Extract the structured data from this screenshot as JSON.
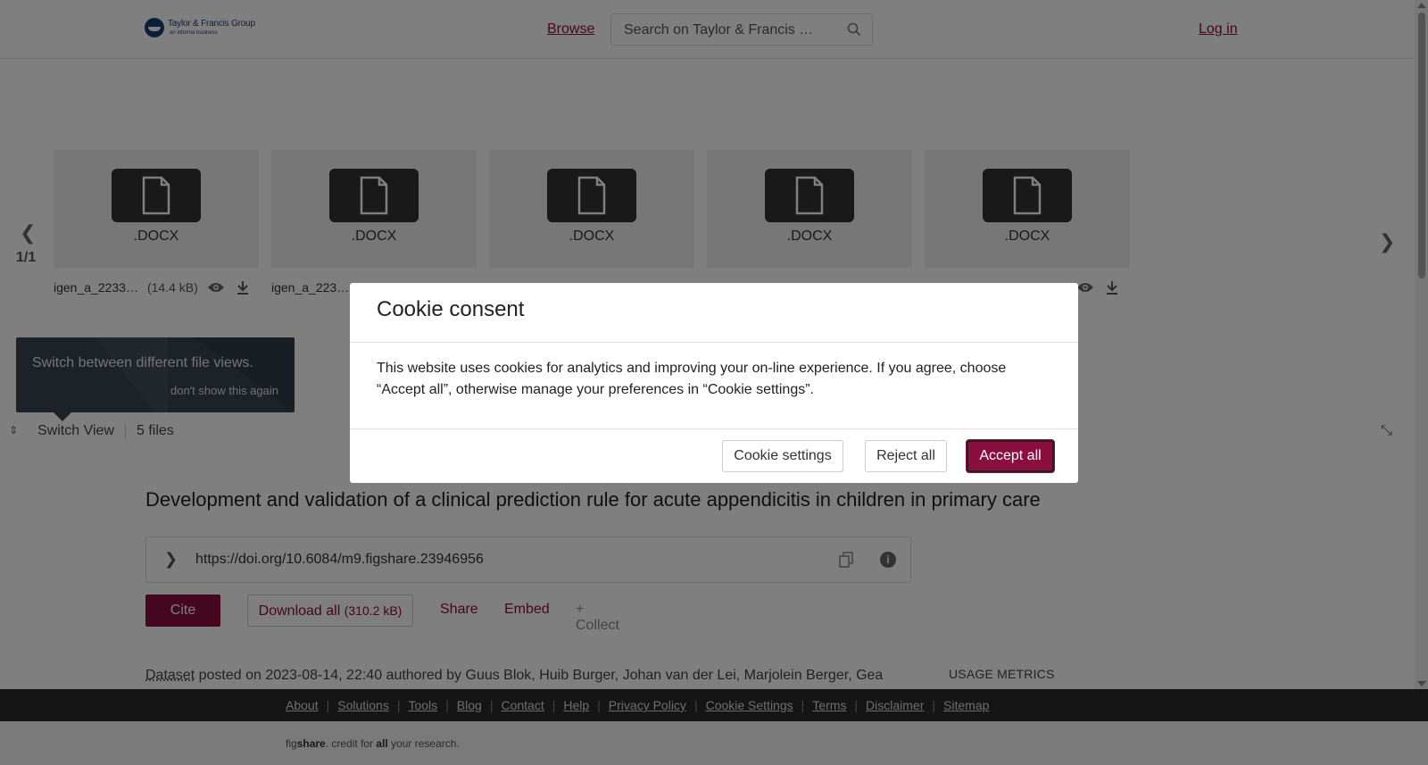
{
  "header": {
    "logo_main": "Taylor & Francis Group",
    "logo_sub": "an informa business",
    "browse": "Browse",
    "search_placeholder": "Search on Taylor & Francis …",
    "login": "Log in"
  },
  "carousel": {
    "counter": "1/1",
    "files": [
      {
        "ext": ".DOCX",
        "name": "igen_a_2233…",
        "size": "(14.4 kB)"
      },
      {
        "ext": ".DOCX",
        "name": "igen_a_223…",
        "size": ""
      },
      {
        "ext": ".DOCX",
        "name": "",
        "size": ""
      },
      {
        "ext": ".DOCX",
        "name": "",
        "size": ""
      },
      {
        "ext": ".DOCX",
        "name": "",
        "size": ""
      }
    ],
    "tooltip_text": "Switch between different file views.",
    "tooltip_dismiss": "don't show this again",
    "switch_view": "Switch View",
    "files_count": "5 files"
  },
  "main": {
    "title": "Development and validation of a clinical prediction rule for acute appendicitis in children in primary care",
    "doi": "https://doi.org/10.6084/m9.figshare.23946956",
    "cite": "Cite",
    "download_all": "Download all",
    "download_size": "(310.2 kB)",
    "share": "Share",
    "embed": "Embed",
    "collect": "+ Collect",
    "posted_type": "Dataset",
    "posted_rest": "posted on 2023-08-14, 22:40 authored by Guus Blok, Huib Burger, Johan van der Lei, Marjolein Berger, Gea Holtman",
    "usage_metrics": "USAGE METRICS"
  },
  "footer": {
    "links": [
      "About",
      "Solutions",
      "Tools",
      "Blog",
      "Contact",
      "Help",
      "Privacy Policy",
      "Cookie Settings",
      "Terms",
      "Disclaimer",
      "Sitemap"
    ],
    "credit_pre": "fig",
    "credit_brand": "share",
    "credit_mid": ". credit for ",
    "credit_all": "all",
    "credit_post": " your research."
  },
  "modal": {
    "title": "Cookie consent",
    "body": "This website uses cookies for analytics and improving your on-line experience. If you agree, choose “Accept all”, otherwise manage your preferences in “Cookie settings”.",
    "settings": "Cookie settings",
    "reject": "Reject all",
    "accept": "Accept all"
  },
  "colors": {
    "brand": "#8a0e3e",
    "footer": "#2b2b2b"
  }
}
